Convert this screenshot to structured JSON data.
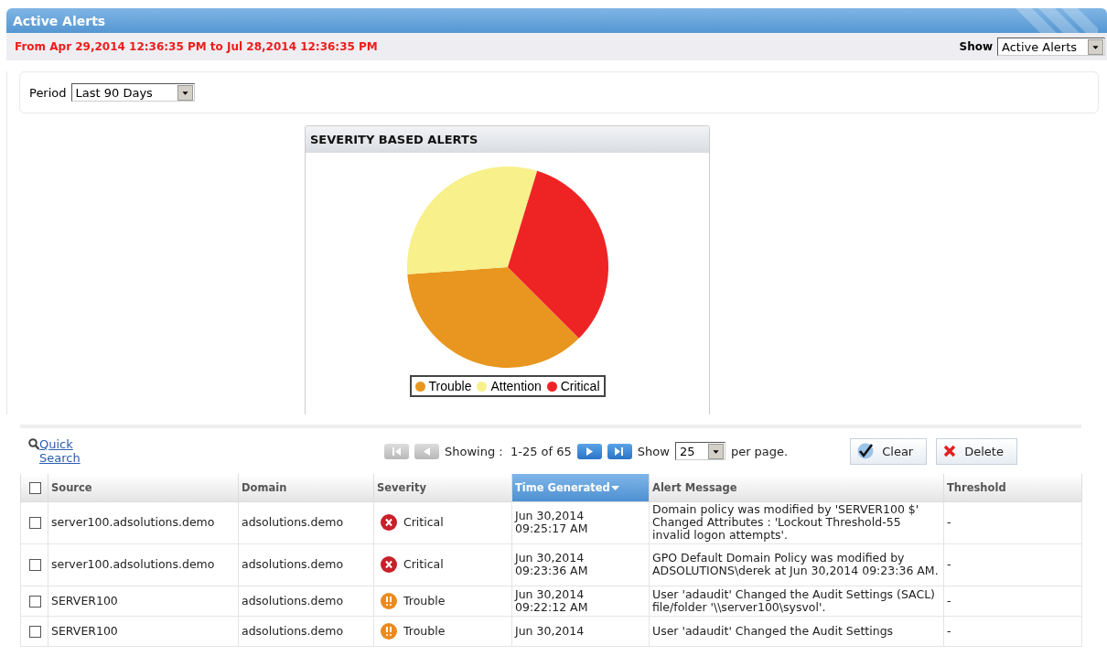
{
  "panel": {
    "title": "Active Alerts"
  },
  "range_text": "From Apr 29,2014 12:36:35 PM to Jul 28,2014 12:36:35 PM",
  "show_filter": {
    "label": "Show",
    "value": "Active Alerts"
  },
  "period": {
    "label": "Period",
    "value": "Last 90 Days"
  },
  "chart": {
    "title": "SEVERITY BASED ALERTS",
    "legend": [
      {
        "label": "Trouble",
        "color": "#e8961f"
      },
      {
        "label": "Attention",
        "color": "#f8f08a"
      },
      {
        "label": "Critical",
        "color": "#ee2424"
      }
    ]
  },
  "toolbar": {
    "quick_search": "Quick Search",
    "pager": [
      {
        "kind": "first",
        "disabled": true
      },
      {
        "kind": "prev",
        "disabled": true
      },
      {
        "kind": "next",
        "disabled": false
      },
      {
        "kind": "last",
        "disabled": false
      }
    ],
    "showing": "Showing :  1-25 of 65",
    "page_size_label": "Show",
    "page_size": "25",
    "per_page": "per page.",
    "buttons": [
      {
        "kind": "clear",
        "label": "Clear"
      },
      {
        "kind": "delete",
        "label": "Delete"
      }
    ]
  },
  "table": {
    "select_all": {
      "checked": false
    },
    "columns": [
      {
        "label": "Source",
        "sorted": false
      },
      {
        "label": "Domain",
        "sorted": false
      },
      {
        "label": "Severity",
        "sorted": false
      },
      {
        "label": "Time Generated",
        "sorted": true
      },
      {
        "label": "Alert Message",
        "sorted": false
      },
      {
        "label": "Threshold",
        "sorted": false
      }
    ],
    "rows": [
      {
        "checked": false,
        "source": "server100.adsolutions.demo",
        "domain": "adsolutions.demo",
        "severity": {
          "kind": "critical",
          "label": "Critical"
        },
        "time": "Jun 30,2014 09:25:17 AM",
        "message": "Domain policy was modified by 'SERVER100 $' Changed Attributes : 'Lockout Threshold-55 invalid logon attempts'.",
        "threshold": "-"
      },
      {
        "checked": false,
        "source": "server100.adsolutions.demo",
        "domain": "adsolutions.demo",
        "severity": {
          "kind": "critical",
          "label": "Critical"
        },
        "time": "Jun 30,2014 09:23:36 AM",
        "message": "GPO Default Domain Policy was modified by ADSOLUTIONS\\derek at Jun 30,2014 09:23:36 AM.",
        "threshold": "-"
      },
      {
        "checked": false,
        "source": "SERVER100",
        "domain": "adsolutions.demo",
        "severity": {
          "kind": "trouble",
          "label": "Trouble"
        },
        "time": "Jun 30,2014 09:22:12 AM",
        "message": "User 'adaudit' Changed the Audit Settings (SACL) file/folder '\\\\server100\\sysvol'.",
        "threshold": "-"
      },
      {
        "checked": false,
        "source": "SERVER100",
        "domain": "adsolutions.demo",
        "severity": {
          "kind": "trouble",
          "label": "Trouble"
        },
        "time": "Jun 30,2014",
        "message": "User 'adaudit' Changed the Audit Settings",
        "threshold": "-"
      }
    ]
  }
}
